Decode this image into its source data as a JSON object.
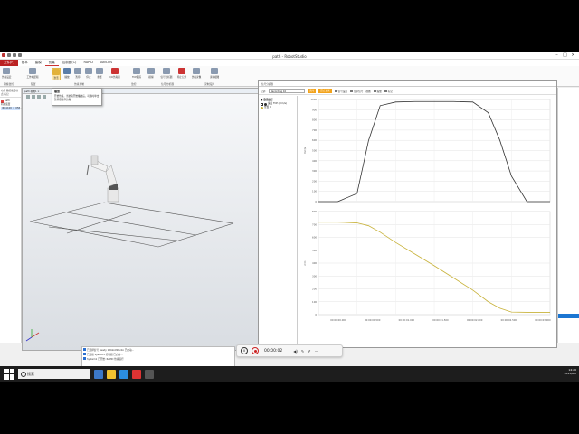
{
  "app": {
    "title": "path - RobotStudio"
  },
  "ribbon": {
    "tabs": [
      "文件(F)",
      "基本",
      "建模",
      "仿真",
      "控制器(C)",
      "RAPID",
      "Add-Ins"
    ],
    "context_tab": "",
    "buttons": [
      {
        "label": "仿真设定"
      },
      {
        "label": "工作站逻辑"
      },
      {
        "label": "激活"
      },
      {
        "label": "播放"
      },
      {
        "label": "暂停"
      },
      {
        "label": "停止"
      },
      {
        "label": "重置"
      },
      {
        "label": "I/O仿真器"
      },
      {
        "label": "TCP跟踪"
      },
      {
        "label": "模拟"
      },
      {
        "label": "信号分析器"
      },
      {
        "label": "停止记录"
      },
      {
        "label": "仿真录像"
      },
      {
        "label": "录制视图"
      }
    ],
    "groups": [
      "碰撞监控",
      "配置",
      "仿真控制",
      "监控",
      "信号分析器",
      "录制短片"
    ]
  },
  "tooltip": {
    "title": "播放",
    "body": "开始仿真。当仿真开始播放后，可随时单击暂停键暂停仿真。"
  },
  "left_panel": {
    "tabs": "布局  路径和目标点  标记",
    "tree": [
      "path",
      "机械装置",
      "IRB1100_4_058..."
    ]
  },
  "viewport": {
    "header": "path:视图1 ×"
  },
  "analyzer": {
    "title": "信号分析器",
    "toolbar": {
      "label": "记录:",
      "dropdown": "Recording 10",
      "btn_live": "实时",
      "btn_history": "历史记录",
      "items": [
        "信号设置",
        "显示信号",
        "视图",
        "缩放",
        "标记"
      ]
    },
    "signal_list": {
      "header": "■ 数值信号",
      "rows": [
        {
          "label": "速度 TCP (mm/s)",
          "color": "#333333"
        },
        {
          "label": "位置 X",
          "color": "#c8b23a"
        }
      ]
    }
  },
  "chart_data": [
    {
      "type": "line",
      "title": "",
      "xlabel": "",
      "ylabel": "mm/s",
      "ylim": [
        0,
        1000
      ],
      "yticks": [
        0,
        100,
        200,
        300,
        400,
        500,
        600,
        700,
        800,
        900,
        1000
      ],
      "grid": true,
      "x": [
        0.0,
        0.5,
        1.0,
        1.3,
        1.6,
        2.0,
        2.5,
        3.0,
        3.5,
        4.0,
        4.4,
        4.7,
        5.0,
        5.4,
        6.0
      ],
      "series": [
        {
          "values": [
            0,
            0,
            80,
            600,
            940,
            975,
            980,
            980,
            980,
            975,
            870,
            600,
            250,
            0,
            0
          ],
          "color": "#333333"
        }
      ]
    },
    {
      "type": "line",
      "title": "",
      "xlabel": "",
      "ylabel": "mm",
      "ylim": [
        0,
        800
      ],
      "yticks": [
        0,
        100,
        200,
        300,
        400,
        500,
        600,
        700,
        800
      ],
      "grid": true,
      "x": [
        0.0,
        0.5,
        1.0,
        1.3,
        1.6,
        2.0,
        2.5,
        3.0,
        3.5,
        4.0,
        4.4,
        4.7,
        5.0,
        5.4,
        6.0
      ],
      "series": [
        {
          "values": [
            718,
            718,
            712,
            690,
            640,
            560,
            470,
            380,
            285,
            190,
            100,
            50,
            20,
            18,
            18
          ],
          "color": "#c8b23a"
        }
      ],
      "xtick_labels": [
        "00:00:00.000",
        "00:00:00.500",
        "00:00:01.000",
        "00:00:01.500",
        "00:00:02.000",
        "00:00:02.500",
        "00:00:03.000"
      ]
    }
  ],
  "output": {
    "lines": [
      "已选择信号 Ready 1 RobotStudio 已启动…",
      "已连接 System1 控制器 已启动…",
      "System1 已开始: RAPID 仿真运行"
    ]
  },
  "media": {
    "time": "00:00:02",
    "pause": "II"
  },
  "taskbar": {
    "search": "搜索",
    "time": "14:26",
    "date": "2023/6/2"
  }
}
